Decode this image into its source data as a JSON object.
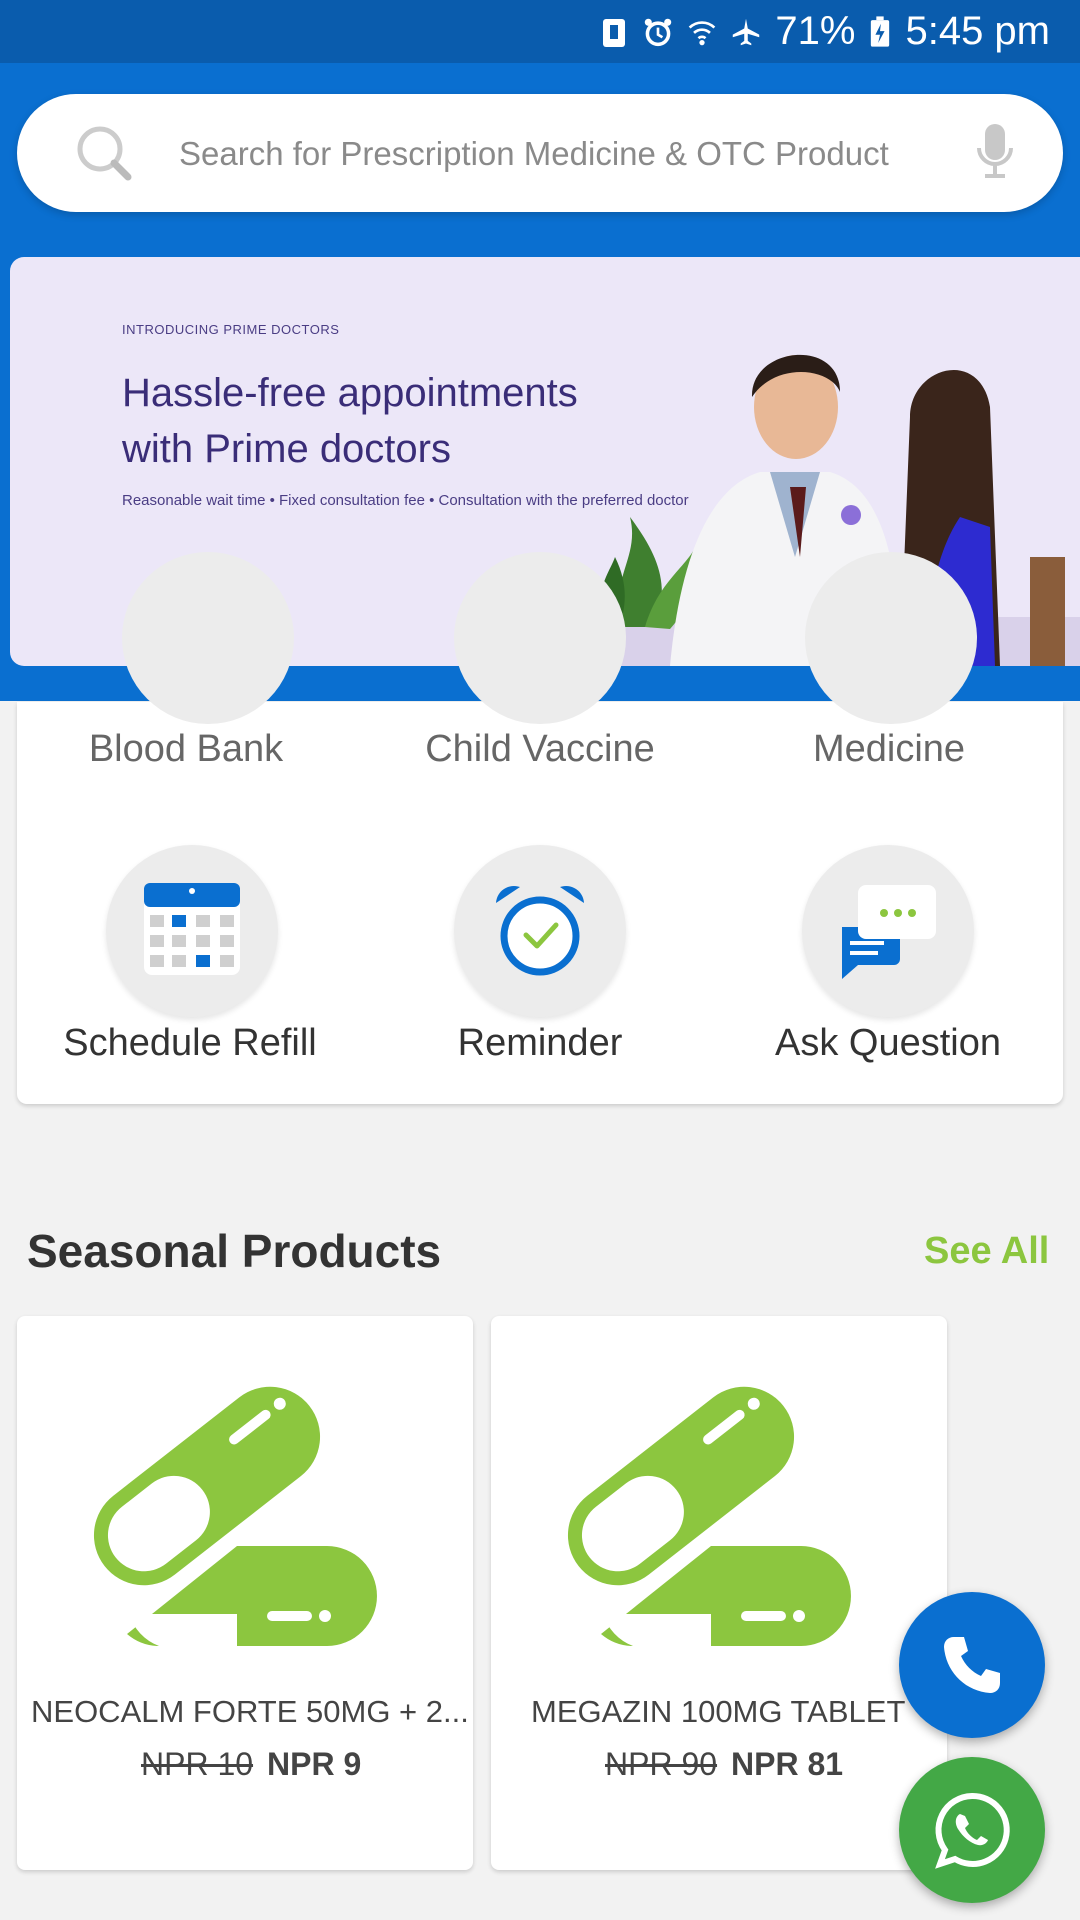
{
  "status_bar": {
    "battery": "71%",
    "time": "5:45 pm"
  },
  "search": {
    "placeholder": "Search for Prescription Medicine & OTC Product"
  },
  "banner": {
    "kicker": "INTRODUCING PRIME DOCTORS",
    "title_line1": "Hassle-free appointments",
    "title_line2": "with Prime doctors",
    "subtitle": "Reasonable wait time  •  Fixed consultation fee  •  Consultation with the preferred doctor",
    "active_slide": 2,
    "slide_count": 3
  },
  "features_row1": [
    {
      "label": "Blood Bank"
    },
    {
      "label": "Child Vaccine"
    },
    {
      "label": "Medicine"
    }
  ],
  "features_row2": [
    {
      "label": "Schedule Refill",
      "icon": "calendar-icon"
    },
    {
      "label": "Reminder",
      "icon": "alarm-clock-icon"
    },
    {
      "label": "Ask Question",
      "icon": "chat-bubbles-icon"
    }
  ],
  "seasonal": {
    "title": "Seasonal Products",
    "see_all": "See All",
    "products": [
      {
        "name": "NEOCALM FORTE 50MG + 2...",
        "old_price": "NPR 10",
        "new_price": "NPR 9"
      },
      {
        "name": "MEGAZIN 100MG TABLET",
        "old_price": "NPR 90",
        "new_price": "NPR 81"
      }
    ]
  },
  "colors": {
    "primary": "#0a6fd0",
    "accent": "#8cc63f",
    "whatsapp": "#43a846"
  }
}
